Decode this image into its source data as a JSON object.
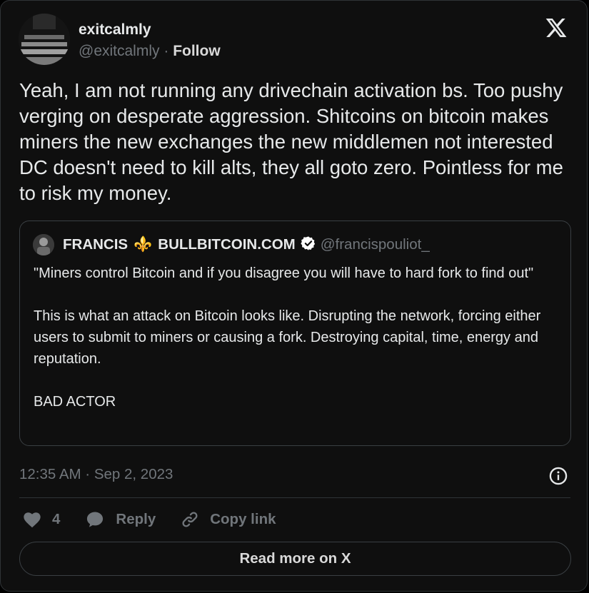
{
  "author": {
    "name": "exitcalmly",
    "handle": "@exitcalmly",
    "separator": " · ",
    "follow_label": "Follow"
  },
  "tweet": {
    "text": "Yeah, I am not running any drivechain activation bs. Too pushy verging on desperate aggression. Shitcoins on bitcoin makes miners the new exchanges the new middlemen not interested DC doesn't need to kill alts, they all goto zero. Pointless for me to risk my money."
  },
  "quote": {
    "name_part1": "FRANCIS",
    "emoji": "⚜️",
    "name_part2": "BULLBITCOIN.COM",
    "handle": "@francispouliot_",
    "paragraphs": [
      "\"Miners control Bitcoin and if you disagree you will have to hard fork to find out\"",
      "This is what an attack on Bitcoin looks like. Disrupting the network, forcing either users to submit to miners or causing a fork. Destroying capital, time, energy and reputation.",
      "BAD ACTOR"
    ]
  },
  "meta": {
    "timestamp": "12:35 AM · Sep 2, 2023"
  },
  "actions": {
    "like_count": "4",
    "reply_label": "Reply",
    "copy_label": "Copy link",
    "read_more_label": "Read more on X"
  },
  "colors": {
    "background": "#0f0f0f",
    "text": "#e7e9ea",
    "muted": "#71767b",
    "border": "#2f3336",
    "verified": "#ffffff"
  },
  "icons": [
    "x-logo-icon",
    "verified-icon",
    "info-icon",
    "heart-icon",
    "reply-icon",
    "link-icon"
  ]
}
